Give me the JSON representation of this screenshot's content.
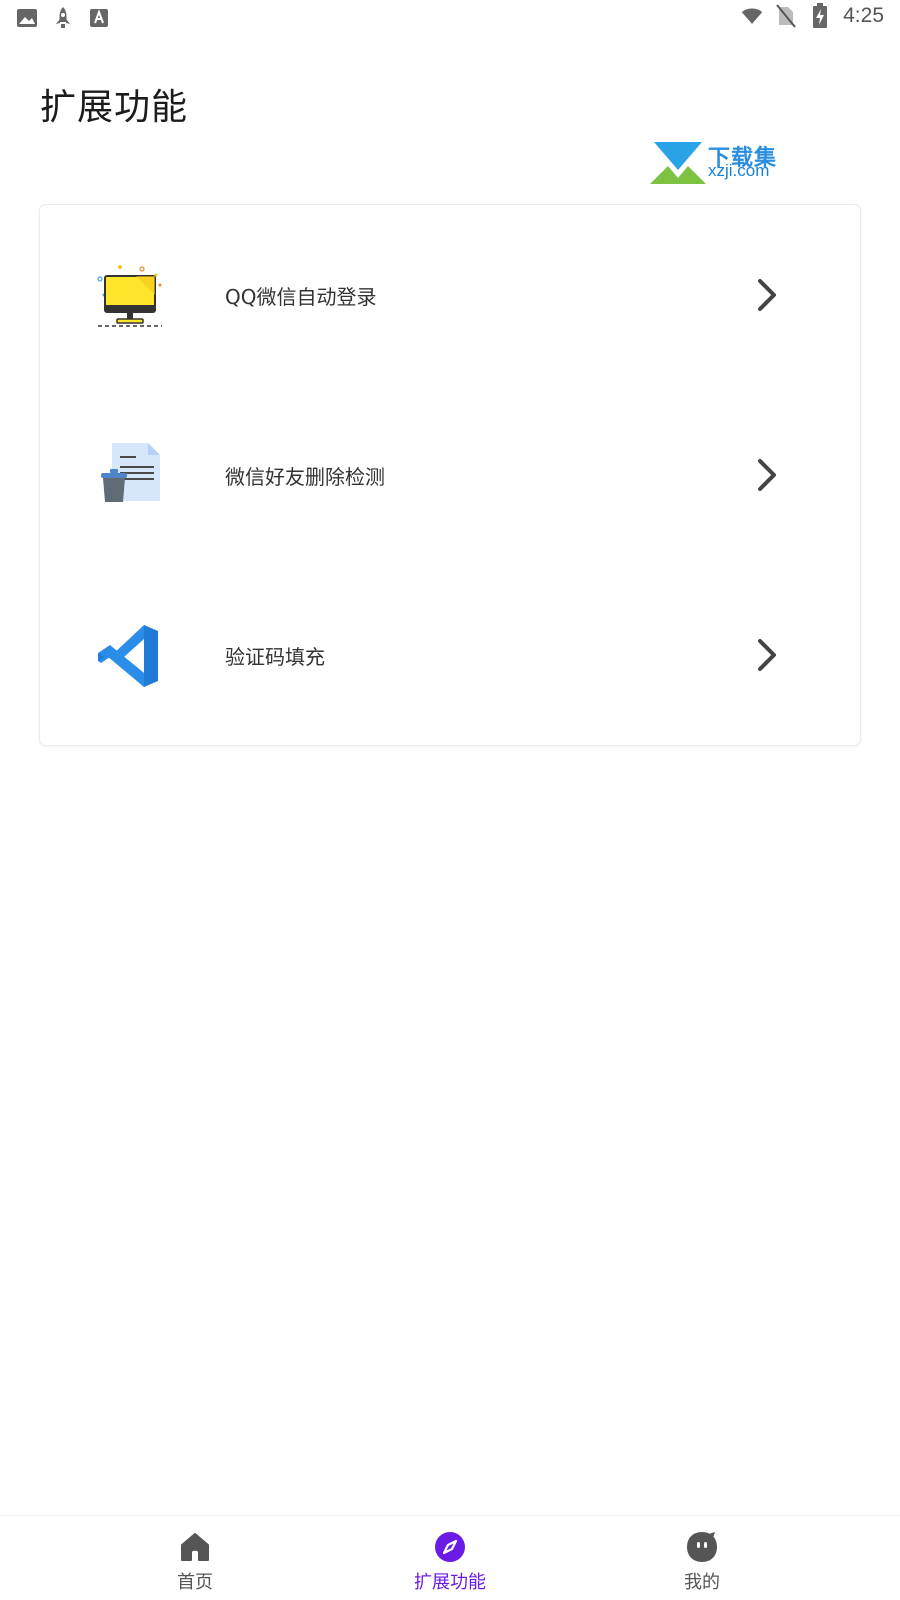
{
  "status_bar": {
    "time": "4:25",
    "left_icons": [
      "image-icon",
      "rocket-icon",
      "font-icon"
    ],
    "right_icons": [
      "wifi-icon",
      "no-sim-icon",
      "battery-charging-icon"
    ]
  },
  "page_title": "扩展功能",
  "watermark": {
    "cn": "下载集",
    "en": "xzji.com"
  },
  "features": [
    {
      "label": "QQ微信自动登录",
      "icon": "monitor-icon"
    },
    {
      "label": "微信好友删除检测",
      "icon": "document-trash-icon"
    },
    {
      "label": "验证码填充",
      "icon": "vscode-icon"
    }
  ],
  "bottom_nav": {
    "items": [
      {
        "label": "首页",
        "icon": "home-icon"
      },
      {
        "label": "扩展功能",
        "icon": "compass-icon",
        "active": true
      },
      {
        "label": "我的",
        "icon": "face-icon"
      }
    ]
  },
  "colors": {
    "accent": "#6a1ce6",
    "icon_dark": "#555555",
    "vscode_blue": "#2a8ee8"
  }
}
